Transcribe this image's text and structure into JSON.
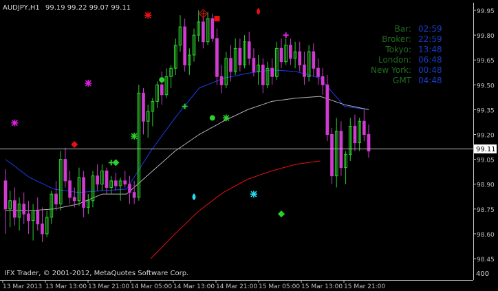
{
  "header": {
    "symbol_tf": "AUDJPY,H1",
    "ohlc": "99.19 99.22 99.07 99.11"
  },
  "footer": {
    "copyright": "IFX Trader, © 2001-2012, MetaQuotes Software Corp.",
    "right_value": "400"
  },
  "current_price": "99.11",
  "clock_panel": [
    {
      "label": "Bar:",
      "value": "02:59"
    },
    {
      "label": "Broker:",
      "value": "22:59"
    },
    {
      "label": "Tokyo:",
      "value": "13:48"
    },
    {
      "label": "London:",
      "value": "06:48"
    },
    {
      "label": "New York:",
      "value": "00:48"
    },
    {
      "label": "GMT",
      "value": "04:48"
    }
  ],
  "colors": {
    "background": "#000000",
    "bull_candle": "#2bd12b",
    "bear_candle": "#d13bd1",
    "ma_blue": "#1c3cf0",
    "ma_gray": "#b4b4b4",
    "ma_red": "#e81010",
    "axis": "#c0c0c0"
  },
  "chart_data": {
    "type": "candlestick",
    "y_ticks": [
      "99.95",
      "99.80",
      "99.65",
      "99.50",
      "99.35",
      "99.20",
      "99.05",
      "98.90",
      "98.75",
      "98.60",
      "98.45"
    ],
    "x_ticks": [
      "13 Mar 2013",
      "13 Mar 13:00",
      "13 Mar 21:00",
      "14 Mar 05:00",
      "14 Mar 13:00",
      "14 Mar 21:00",
      "15 Mar 05:00",
      "15 Mar 13:00",
      "15 Mar 21:00"
    ],
    "ylim": [
      98.41,
      99.99
    ],
    "candles": [
      [
        98.92,
        98.99,
        98.6,
        98.75
      ],
      [
        98.75,
        98.86,
        98.64,
        98.8
      ],
      [
        98.8,
        98.88,
        98.65,
        98.7
      ],
      [
        98.7,
        98.82,
        98.62,
        98.78
      ],
      [
        98.78,
        98.85,
        98.66,
        98.72
      ],
      [
        98.72,
        98.8,
        98.6,
        98.68
      ],
      [
        98.68,
        98.78,
        98.56,
        98.74
      ],
      [
        98.74,
        98.82,
        98.62,
        98.66
      ],
      [
        98.66,
        98.76,
        98.55,
        98.6
      ],
      [
        98.6,
        98.74,
        98.58,
        98.7
      ],
      [
        98.7,
        98.86,
        98.66,
        98.84
      ],
      [
        98.84,
        98.92,
        98.74,
        98.78
      ],
      [
        98.78,
        99.1,
        98.74,
        99.05
      ],
      [
        99.05,
        99.12,
        98.88,
        98.92
      ],
      [
        98.92,
        98.98,
        98.78,
        98.82
      ],
      [
        98.82,
        98.88,
        98.76,
        98.8
      ],
      [
        98.8,
        99.0,
        98.77,
        98.94
      ],
      [
        98.94,
        98.98,
        98.7,
        98.76
      ],
      [
        98.76,
        98.84,
        98.72,
        98.8
      ],
      [
        98.8,
        98.98,
        98.76,
        98.95
      ],
      [
        98.95,
        99.02,
        98.86,
        98.9
      ],
      [
        98.9,
        99.02,
        98.86,
        98.98
      ],
      [
        98.98,
        99.0,
        98.84,
        98.88
      ],
      [
        98.88,
        98.95,
        98.84,
        98.92
      ],
      [
        98.92,
        98.97,
        98.86,
        98.89
      ],
      [
        98.89,
        98.94,
        98.8,
        98.92
      ],
      [
        98.92,
        98.98,
        98.88,
        98.9
      ],
      [
        98.9,
        98.95,
        98.78,
        98.85
      ],
      [
        98.85,
        98.92,
        98.78,
        98.82
      ],
      [
        98.82,
        99.5,
        98.8,
        99.45
      ],
      [
        99.45,
        99.48,
        99.2,
        99.28
      ],
      [
        99.28,
        99.38,
        99.18,
        99.34
      ],
      [
        99.34,
        99.42,
        99.25,
        99.4
      ],
      [
        99.4,
        99.52,
        99.36,
        99.5
      ],
      [
        99.5,
        99.58,
        99.38,
        99.44
      ],
      [
        99.44,
        99.6,
        99.42,
        99.55
      ],
      [
        99.55,
        99.62,
        99.48,
        99.6
      ],
      [
        99.6,
        99.78,
        99.56,
        99.74
      ],
      [
        99.74,
        99.92,
        99.7,
        99.85
      ],
      [
        99.85,
        99.9,
        99.58,
        99.62
      ],
      [
        99.62,
        99.72,
        99.56,
        99.68
      ],
      [
        99.68,
        99.84,
        99.64,
        99.8
      ],
      [
        99.8,
        99.95,
        99.76,
        99.88
      ],
      [
        99.88,
        99.92,
        99.72,
        99.76
      ],
      [
        99.76,
        99.94,
        99.74,
        99.9
      ],
      [
        99.9,
        99.93,
        99.76,
        99.78
      ],
      [
        99.78,
        99.84,
        99.5,
        99.55
      ],
      [
        99.55,
        99.62,
        99.45,
        99.5
      ],
      [
        99.5,
        99.7,
        99.48,
        99.66
      ],
      [
        99.66,
        99.74,
        99.52,
        99.58
      ],
      [
        99.58,
        99.78,
        99.56,
        99.72
      ],
      [
        99.72,
        99.78,
        99.58,
        99.62
      ],
      [
        99.62,
        99.8,
        99.6,
        99.76
      ],
      [
        99.76,
        99.82,
        99.62,
        99.66
      ],
      [
        99.66,
        99.72,
        99.55,
        99.58
      ],
      [
        99.58,
        99.68,
        99.5,
        99.62
      ],
      [
        99.62,
        99.66,
        99.45,
        99.5
      ],
      [
        99.5,
        99.64,
        99.48,
        99.6
      ],
      [
        99.6,
        99.66,
        99.5,
        99.55
      ],
      [
        99.55,
        99.76,
        99.53,
        99.72
      ],
      [
        99.72,
        99.78,
        99.6,
        99.64
      ],
      [
        99.64,
        99.78,
        99.62,
        99.74
      ],
      [
        99.74,
        99.78,
        99.62,
        99.66
      ],
      [
        99.66,
        99.76,
        99.6,
        99.7
      ],
      [
        99.7,
        99.76,
        99.58,
        99.62
      ],
      [
        99.62,
        99.7,
        99.5,
        99.55
      ],
      [
        99.55,
        99.74,
        99.52,
        99.7
      ],
      [
        99.7,
        99.75,
        99.55,
        99.6
      ],
      [
        99.6,
        99.66,
        99.5,
        99.55
      ],
      [
        99.55,
        99.6,
        99.44,
        99.5
      ],
      [
        99.5,
        99.56,
        99.16,
        99.2
      ],
      [
        99.2,
        99.24,
        98.9,
        98.95
      ],
      [
        98.95,
        99.3,
        98.88,
        99.22
      ],
      [
        99.22,
        99.28,
        98.95,
        99.0
      ],
      [
        99.0,
        99.1,
        98.9,
        99.08
      ],
      [
        99.08,
        99.3,
        99.04,
        99.25
      ],
      [
        99.25,
        99.32,
        99.1,
        99.15
      ],
      [
        99.15,
        99.3,
        99.1,
        99.28
      ],
      [
        99.28,
        99.35,
        99.16,
        99.2
      ],
      [
        99.2,
        99.26,
        99.06,
        99.1
      ]
    ],
    "moving_averages": [
      {
        "color": "#1c3cf0",
        "values": [
          99.05,
          98.94,
          98.87,
          98.85,
          98.86,
          98.87,
          99.1,
          99.3,
          99.48,
          99.54,
          99.57,
          99.59,
          99.58,
          99.54,
          99.37,
          99.35
        ]
      },
      {
        "color": "#b4b4b4",
        "values": [
          98.74,
          98.74,
          98.75,
          98.78,
          98.84,
          98.84,
          98.97,
          99.1,
          99.2,
          99.28,
          99.35,
          99.4,
          99.42,
          99.43,
          99.38,
          99.35
        ]
      },
      {
        "color": "#e81010",
        "values": [
          null,
          null,
          null,
          null,
          null,
          null,
          98.45,
          98.6,
          98.74,
          98.85,
          98.93,
          98.98,
          99.02,
          99.04,
          null,
          null
        ]
      }
    ],
    "signals": [
      {
        "shape": "star",
        "color": "#e020e0",
        "candle": 2,
        "price": 99.27
      },
      {
        "shape": "diamond",
        "color": "#e81010",
        "candle": 15,
        "price": 99.14
      },
      {
        "shape": "star",
        "color": "#e020e0",
        "candle": 18,
        "price": 99.51
      },
      {
        "shape": "plus",
        "color": "#2bd12b",
        "candle": 23,
        "price": 99.03
      },
      {
        "shape": "diamond",
        "color": "#2bd12b",
        "candle": 24,
        "price": 99.03
      },
      {
        "shape": "star",
        "color": "#2bd12b",
        "candle": 28,
        "price": 99.19
      },
      {
        "shape": "star",
        "color": "#e81010",
        "candle": 31,
        "price": 99.92
      },
      {
        "shape": "dot",
        "color": "#2bd12b",
        "candle": 34,
        "price": 99.53
      },
      {
        "shape": "plus",
        "color": "#2bd12b",
        "candle": 39,
        "price": 99.37
      },
      {
        "shape": "drop",
        "color": "#20e0f0",
        "candle": 41,
        "price": 98.82
      },
      {
        "shape": "target",
        "color": "#e81010",
        "candle": 43,
        "price": 99.93
      },
      {
        "shape": "dot",
        "color": "#2bd12b",
        "candle": 45,
        "price": 99.3
      },
      {
        "shape": "square",
        "color": "#e81010",
        "candle": 46,
        "price": 99.9
      },
      {
        "shape": "star",
        "color": "#2bd12b",
        "candle": 48,
        "price": 99.3
      },
      {
        "shape": "star",
        "color": "#20e0f0",
        "candle": 54,
        "price": 98.84
      },
      {
        "shape": "drop",
        "color": "#e81010",
        "candle": 55,
        "price": 99.94
      },
      {
        "shape": "diamond",
        "color": "#2bd12b",
        "candle": 60,
        "price": 98.72
      },
      {
        "shape": "plus",
        "color": "#e020e0",
        "candle": 61,
        "price": 99.8
      }
    ],
    "grid": false,
    "current_price": 99.11
  }
}
